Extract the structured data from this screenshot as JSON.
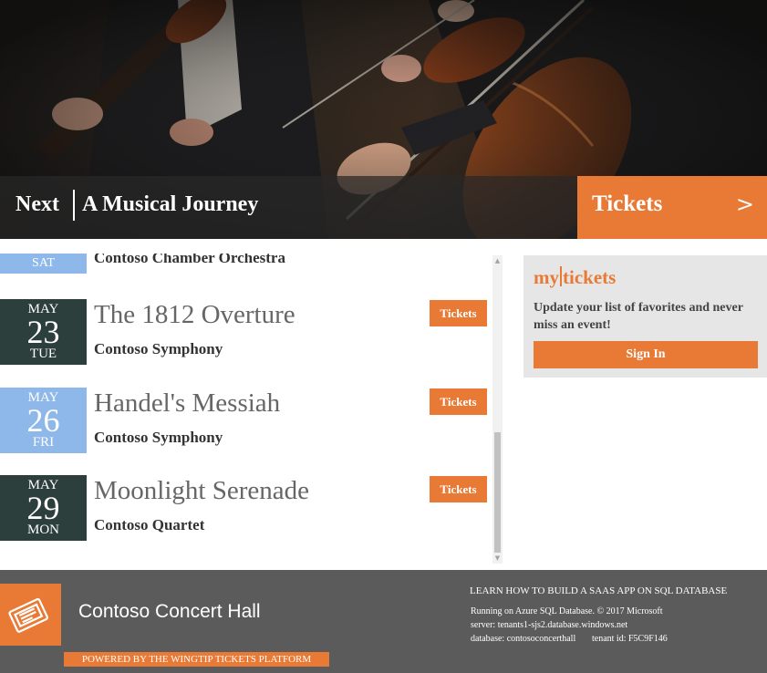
{
  "hero": {
    "next_label": "Next",
    "subtitle": "A Musical Journey",
    "tickets_label": "Tickets",
    "tickets_arrow": ">"
  },
  "events": {
    "partial": {
      "dow": "SAT",
      "venue": "Contoso Chamber Orchestra"
    },
    "items": [
      {
        "month": "MAY",
        "day": "23",
        "dow": "TUE",
        "title": "The 1812 Overture",
        "venue": "Contoso Symphony",
        "button": "Tickets"
      },
      {
        "month": "MAY",
        "day": "26",
        "dow": "FRI",
        "title": "Handel's Messiah",
        "venue": "Contoso Symphony",
        "button": "Tickets"
      },
      {
        "month": "MAY",
        "day": "29",
        "dow": "MON",
        "title": "Moonlight Serenade",
        "venue": "Contoso Quartet",
        "button": "Tickets"
      }
    ]
  },
  "scrollbar": {
    "up_glyph": "▲",
    "down_glyph": "▼"
  },
  "mytickets": {
    "logo_my": "my",
    "logo_tickets": "tickets",
    "description": "Update your list of favorites and never miss an event!",
    "signin_label": "Sign In"
  },
  "footer": {
    "venue_name": "Contoso Concert Hall",
    "powered_by": "POWERED BY THE WINGTIP TICKETS PLATFORM",
    "learn_link": "LEARN HOW TO BUILD A SAAS APP ON SQL DATABASE",
    "running_on": "Running on Azure SQL Database. © 2017 Microsoft",
    "server": "server: tenants1-sjs2.database.windows.net",
    "database": "database: contosoconcerthall",
    "tenant": "tenant id: F5C9F146"
  },
  "colors": {
    "accent": "#e87a35",
    "date_dark": "#2d3f3c",
    "date_light": "#8fb8ea",
    "footer_bg": "#5b5b5b",
    "panel_bg": "#e6e6e6"
  },
  "icons": {
    "venue_logo": "ticket-icon"
  }
}
